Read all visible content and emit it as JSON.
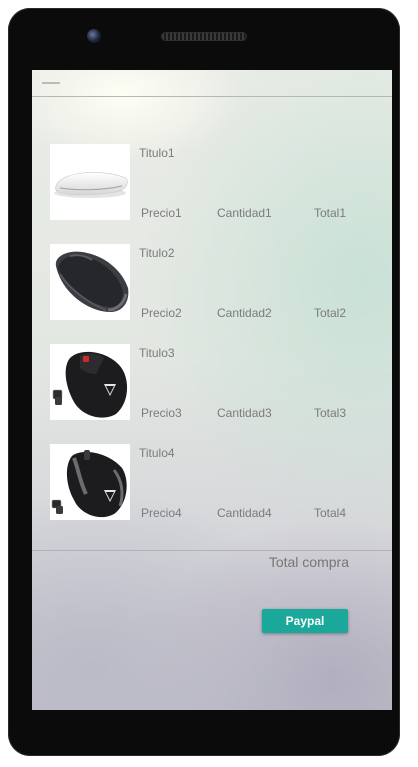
{
  "cart": {
    "items": [
      {
        "title": "Titulo1",
        "price": "Precio1",
        "quantity": "Cantidad1",
        "total": "Total1",
        "image": "white-mouse"
      },
      {
        "title": "Titulo2",
        "price": "Precio2",
        "quantity": "Cantidad2",
        "total": "Total2",
        "image": "gray-mouse"
      },
      {
        "title": "Titulo3",
        "price": "Precio3",
        "quantity": "Cantidad3",
        "total": "Total3",
        "image": "black-mouse-red-wheel"
      },
      {
        "title": "Titulo4",
        "price": "Precio4",
        "quantity": "Cantidad4",
        "total": "Total4",
        "image": "black-mouse-gray-trim"
      }
    ],
    "total_label": "Total compra"
  },
  "actions": {
    "paypal_label": "Paypal"
  },
  "colors": {
    "accent": "#1aa89a",
    "text": "#7b7b7b",
    "device": "#0b0b0b"
  }
}
